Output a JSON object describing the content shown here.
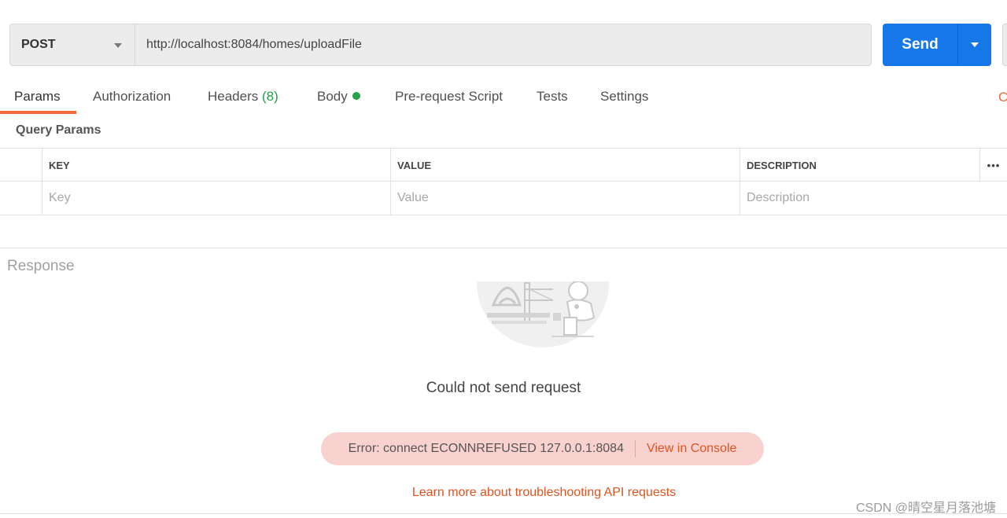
{
  "request": {
    "method": "POST",
    "url": "http://localhost:8084/homes/uploadFile",
    "send_label": "Send"
  },
  "tabs": {
    "params": "Params",
    "authorization": "Authorization",
    "headers": "Headers",
    "headers_count": "(8)",
    "body": "Body",
    "prerequest": "Pre-request Script",
    "tests": "Tests",
    "settings": "Settings",
    "right_stub": "C"
  },
  "query_params": {
    "title": "Query Params",
    "columns": {
      "key": "KEY",
      "value": "VALUE",
      "description": "DESCRIPTION",
      "more": "•••"
    },
    "placeholders": {
      "key": "Key",
      "value": "Value",
      "description": "Description"
    }
  },
  "response": {
    "title": "Response",
    "error_title": "Could not send request",
    "error_message": "Error: connect ECONNREFUSED 127.0.0.1:8084",
    "view_console": "View in Console",
    "learn_more": "Learn more about troubleshooting API requests"
  },
  "watermark": "CSDN @晴空星月落池塘",
  "colors": {
    "send_blue": "#1677e8",
    "accent_orange": "#f26b3a",
    "link_orange": "#e0531f",
    "status_green": "#26a04a",
    "error_pill_bg": "#f9d2cf"
  },
  "icons": [
    "chevron-down-icon",
    "send-dropdown-icon",
    "body-status-dot-icon",
    "more-options-icon",
    "astronaut-illustration"
  ]
}
